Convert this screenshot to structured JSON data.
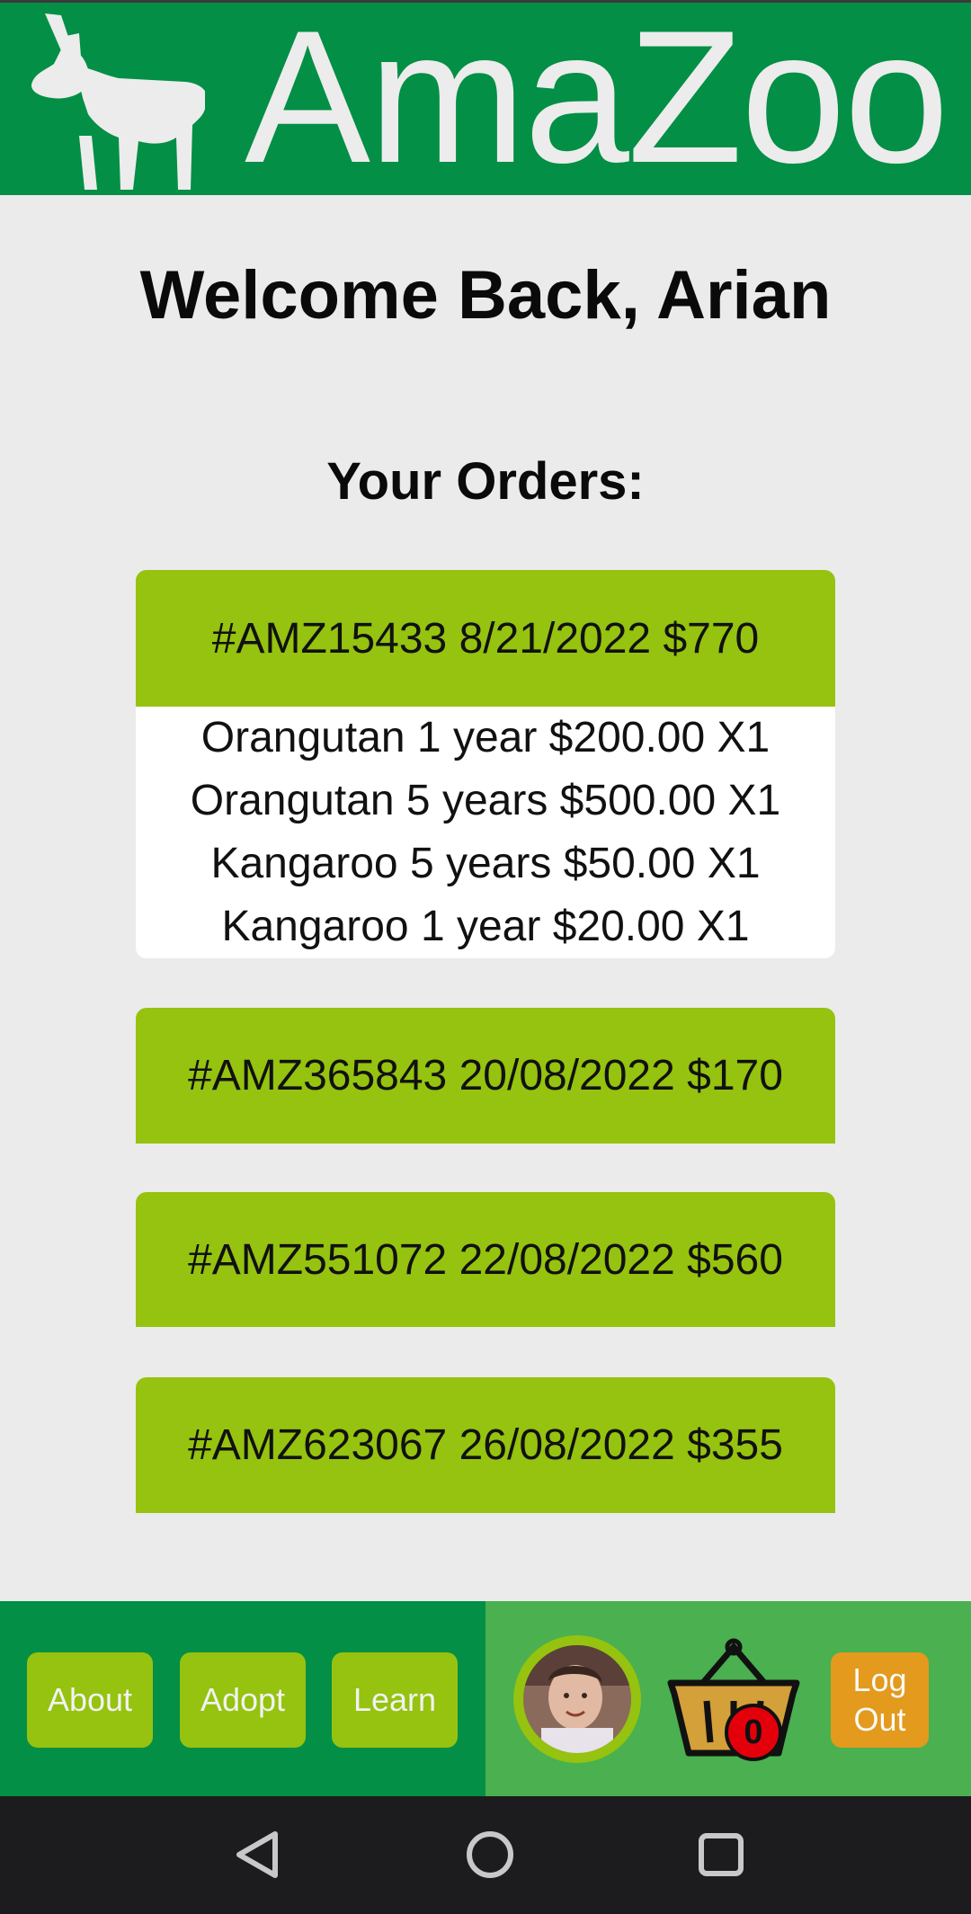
{
  "app": {
    "brand": "AmaZoo"
  },
  "welcome": "Welcome Back, Arian",
  "orders_title": "Your Orders:",
  "orders": [
    {
      "summary": "#AMZ15433 8/21/2022 $770",
      "expanded": true,
      "items": [
        "Orangutan 1 year $200.00 X1",
        "Orangutan 5 years $500.00 X1",
        "Kangaroo 5 years $50.00 X1",
        "Kangaroo 1 year $20.00 X1"
      ]
    },
    {
      "summary": "#AMZ365843 20/08/2022 $170",
      "expanded": false
    },
    {
      "summary": "#AMZ551072 22/08/2022 $560",
      "expanded": false
    },
    {
      "summary": "#AMZ623067 26/08/2022 $355",
      "expanded": false
    }
  ],
  "footer": {
    "nav": [
      "About",
      "Adopt",
      "Learn"
    ],
    "cart_count": "0",
    "logout_line1": "Log",
    "logout_line2": "Out"
  },
  "colors": {
    "header_green": "#038f46",
    "lime": "#95c30f",
    "footer_right": "#4ab050",
    "logout_orange": "#e39a1d",
    "badge_red": "#e3000b"
  },
  "icons": [
    "donkey-logo-icon",
    "user-avatar",
    "basket-icon",
    "back-icon",
    "home-icon",
    "recents-icon"
  ]
}
